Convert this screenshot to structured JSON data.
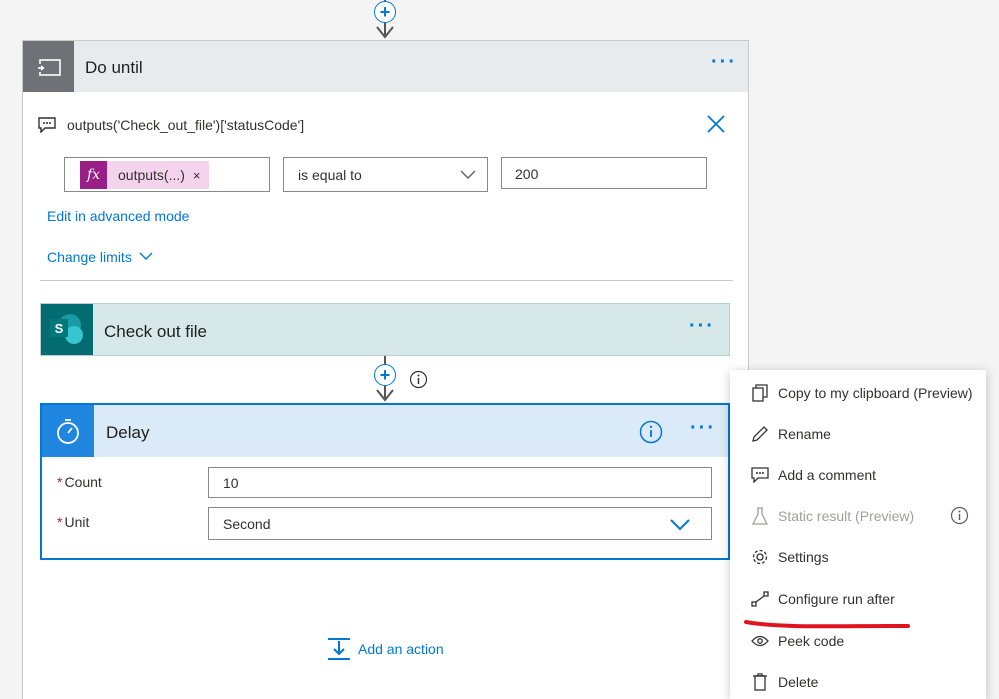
{
  "do_until": {
    "title": "Do until",
    "condition_title": "outputs('Check_out_file')['statusCode']",
    "token_label": "outputs(...)",
    "token_remove": "×",
    "operator": "is equal to",
    "value": "200",
    "edit_advanced": "Edit in advanced mode",
    "change_limits": "Change limits"
  },
  "check_out": {
    "title": "Check out file",
    "icon_letter": "S"
  },
  "delay": {
    "title": "Delay",
    "count_label": "Count",
    "count_value": "10",
    "unit_label": "Unit",
    "unit_value": "Second",
    "required_mark": "*"
  },
  "add_action": "Add an action",
  "context_menu": {
    "items": [
      {
        "label": "Copy to my clipboard (Preview)",
        "icon": "copy-icon"
      },
      {
        "label": "Rename",
        "icon": "pencil-icon"
      },
      {
        "label": "Add a comment",
        "icon": "comment-icon"
      },
      {
        "label": "Static result (Preview)",
        "icon": "beaker-icon",
        "disabled": true
      },
      {
        "label": "Settings",
        "icon": "gear-icon"
      },
      {
        "label": "Configure run after",
        "icon": "run-after-icon"
      },
      {
        "label": "Peek code",
        "icon": "eye-icon"
      },
      {
        "label": "Delete",
        "icon": "trash-icon"
      }
    ]
  },
  "colors": {
    "accent": "#0078d4",
    "annotation": "#e0141e",
    "sharepoint": "#036c70",
    "expression_token": "#981f85"
  }
}
